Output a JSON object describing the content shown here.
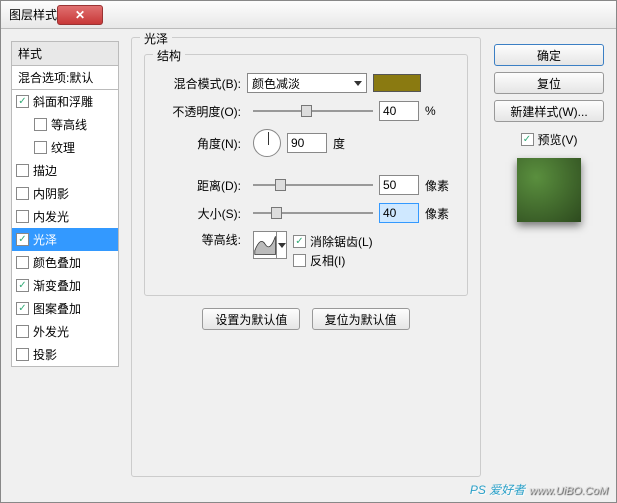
{
  "window": {
    "title": "图层样式"
  },
  "sidebar": {
    "header": "样式",
    "subheader": "混合选项:默认",
    "items": [
      {
        "label": "斜面和浮雕",
        "checked": true,
        "indent": false
      },
      {
        "label": "等高线",
        "checked": false,
        "indent": true
      },
      {
        "label": "纹理",
        "checked": false,
        "indent": true
      },
      {
        "label": "描边",
        "checked": false,
        "indent": false
      },
      {
        "label": "内阴影",
        "checked": false,
        "indent": false
      },
      {
        "label": "内发光",
        "checked": false,
        "indent": false
      },
      {
        "label": "光泽",
        "checked": true,
        "indent": false,
        "selected": true
      },
      {
        "label": "颜色叠加",
        "checked": false,
        "indent": false
      },
      {
        "label": "渐变叠加",
        "checked": true,
        "indent": false
      },
      {
        "label": "图案叠加",
        "checked": true,
        "indent": false
      },
      {
        "label": "外发光",
        "checked": false,
        "indent": false
      },
      {
        "label": "投影",
        "checked": false,
        "indent": false
      }
    ]
  },
  "main": {
    "title": "光泽",
    "group": "结构",
    "blend_label": "混合模式(B):",
    "blend_value": "颜色减淡",
    "color": "#8a7a11",
    "opacity_label": "不透明度(O):",
    "opacity_value": "40",
    "opacity_unit": "%",
    "angle_label": "角度(N):",
    "angle_value": "90",
    "angle_unit": "度",
    "distance_label": "距离(D):",
    "distance_value": "50",
    "distance_unit": "像素",
    "size_label": "大小(S):",
    "size_value": "40",
    "size_unit": "像素",
    "contour_label": "等高线:",
    "antialias_label": "消除锯齿(L)",
    "antialias_checked": true,
    "invert_label": "反相(I)",
    "invert_checked": false,
    "reset_default": "设置为默认值",
    "restore_default": "复位为默认值"
  },
  "right": {
    "ok": "确定",
    "cancel": "复位",
    "newstyle": "新建样式(W)...",
    "preview_label": "预览(V)",
    "preview_checked": true
  },
  "watermark": {
    "brand": "PS 爱好者",
    "url": "www.UiBO.CoM"
  }
}
